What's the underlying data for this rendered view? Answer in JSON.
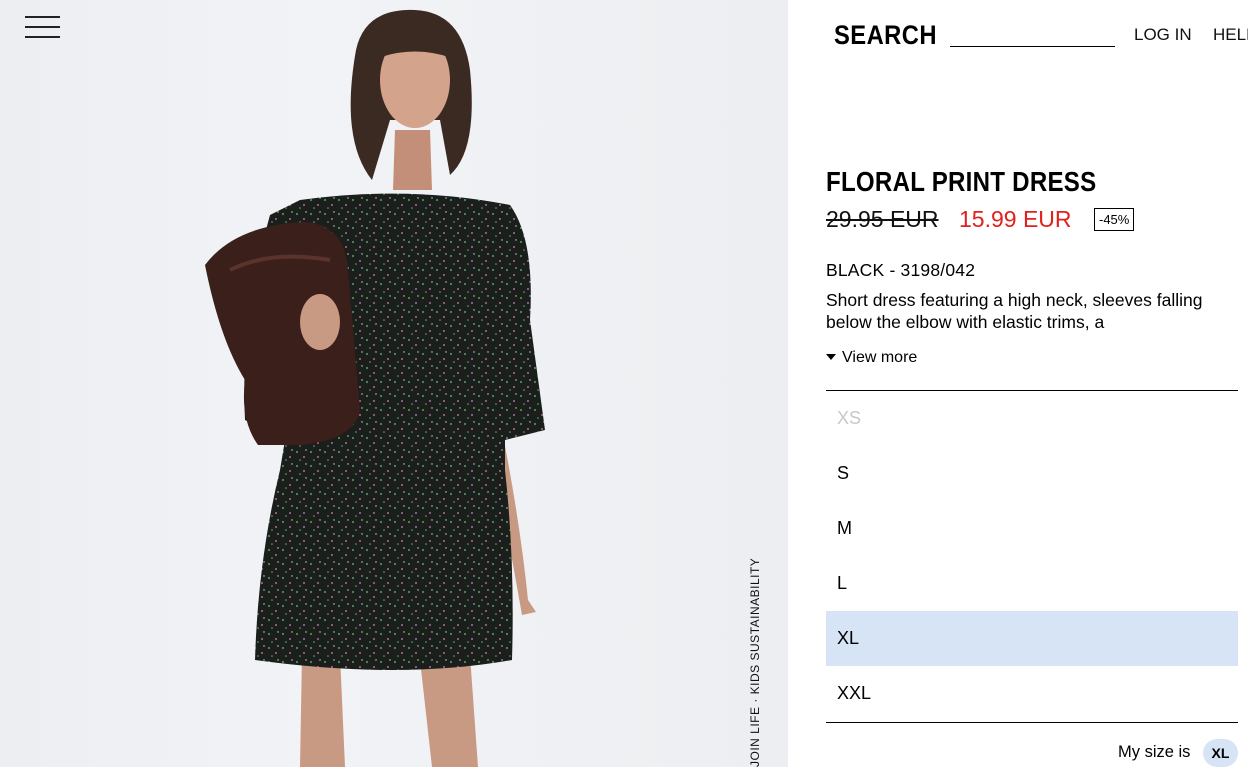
{
  "header": {
    "search_label": "SEARCH",
    "search_value": "",
    "login_label": "LOG IN",
    "help_label": "HELP"
  },
  "side_link": "JOIN LIFE · KIDS SUSTAINABILITY",
  "product": {
    "title": "FLORAL PRINT DRESS",
    "old_price": "29.95 EUR",
    "new_price": "15.99 EUR",
    "discount": "-45%",
    "color_ref": "BLACK - 3198/042",
    "description": "Short dress featuring a high neck, sleeves falling below the elbow with elastic trims, a",
    "view_more": "View more"
  },
  "sizes": [
    {
      "label": "XS",
      "state": "unavailable"
    },
    {
      "label": "S",
      "state": "available"
    },
    {
      "label": "M",
      "state": "available"
    },
    {
      "label": "L",
      "state": "available"
    },
    {
      "label": "XL",
      "state": "selected"
    },
    {
      "label": "XXL",
      "state": "available"
    }
  ],
  "my_size": {
    "label": "My size is",
    "value": "XL"
  },
  "colors": {
    "sale_red": "#e1211b",
    "selected_bg": "#d6e4f6",
    "disabled_text": "#c8c8c8"
  },
  "icons": {
    "menu": "hamburger-menu-icon",
    "view_more": "triangle-down-icon"
  }
}
